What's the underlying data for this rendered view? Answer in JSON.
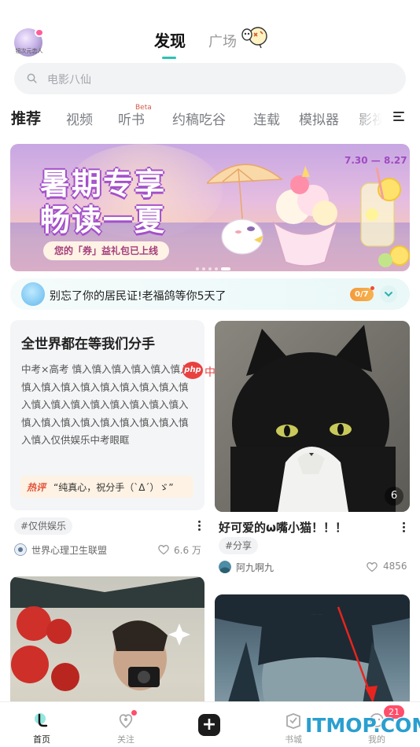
{
  "header": {
    "avatar_caption": "钮次元恋人",
    "tab_discover": "发现",
    "tab_square": "广场"
  },
  "search": {
    "placeholder": "电影八仙"
  },
  "categories": {
    "items": [
      "推荐",
      "视频",
      "听书",
      "约稿吃谷",
      "连载",
      "模拟器",
      "影视"
    ],
    "beta_tag": "Beta"
  },
  "banner": {
    "title_line1": "暑期专享",
    "title_line2": "畅读一夏",
    "subtitle": "您的「券」益礼包已上线",
    "date_range": "7.30 — 8.27"
  },
  "notice": {
    "text": "别忘了你的居民证!老福鸽等你5天了",
    "progress_label": "0/7"
  },
  "feed": {
    "card1": {
      "title": "全世界都在等我们分手",
      "body": "中考×高考 慎入慎入慎入慎入慎入慎入慎入慎入慎入慎入慎入慎入慎入慎入慎入慎入慎入慎入慎入慎入慎入慎入慎入慎入慎入慎入慎入慎入慎入慎入慎入慎入慎入仅供娱乐中考眼眶",
      "hot_label": "热评",
      "hot_comment": "“纯真心，祝分手（`Δ´）ゞ”",
      "tag": "#仅供娱乐",
      "author": "世界心理卫生联盟",
      "likes": "6.6 万"
    },
    "card2": {
      "image_count": "6",
      "caption": "好可爱的ω嘴小猫！！！",
      "tag": "#分享",
      "author": "阿九啊九",
      "likes": "4856"
    }
  },
  "watermark": {
    "php_logo": "php",
    "php_text": "中文网",
    "site": "ITMOP.COM"
  },
  "bottom_nav": {
    "home": "首页",
    "follow": "关注",
    "bookshelf": "书城",
    "me": "我的",
    "me_badge": "21"
  }
}
